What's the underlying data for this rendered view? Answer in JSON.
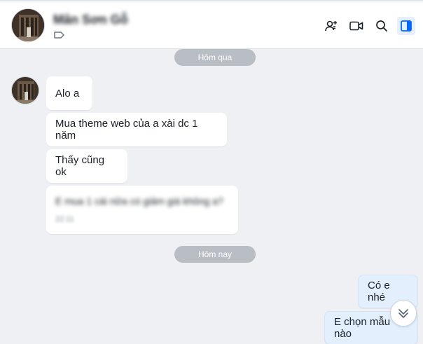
{
  "header": {
    "contact_name": "Mân Sơn Gỗ",
    "actions": [
      {
        "icon": "add-member-icon"
      },
      {
        "icon": "video-call-icon"
      },
      {
        "icon": "search-icon"
      },
      {
        "icon": "conversation-info-icon",
        "active": true
      }
    ]
  },
  "chat": {
    "date_yesterday": "Hôm qua",
    "date_today": "Hôm nay",
    "messages_in": [
      {
        "text": "Alo a"
      },
      {
        "text": "Mua theme web của a xài dc 1 năm"
      },
      {
        "text": "Thấy cũng ok"
      },
      {
        "text": "E mua 1 cái nữa có giảm giá không a?",
        "time": "22:11",
        "blurred": true
      }
    ],
    "messages_out": [
      {
        "text": "Có e nhé"
      },
      {
        "text": "E chọn mẫu nào"
      }
    ]
  },
  "colors": {
    "accent": "#0068ff",
    "chat_background": "#eef0f4",
    "outgoing_bubble": "#e3effd",
    "incoming_bubble": "#ffffff",
    "date_pill": "#b9bdc4"
  }
}
